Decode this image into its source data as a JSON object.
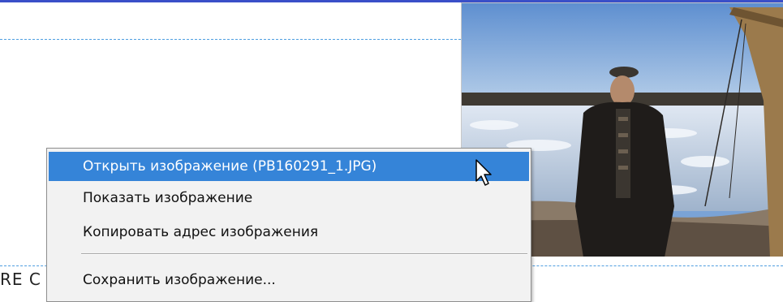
{
  "page": {
    "partial_heading": "RE C"
  },
  "image": {
    "alt": "Photo of a man in a dark winter coat and cap standing on a riverbank with ice floes behind him"
  },
  "context_menu": {
    "items": [
      {
        "label": "Открыть изображение (PB160291_1.JPG)",
        "selected": true
      },
      {
        "label": "Показать изображение",
        "selected": false
      },
      {
        "label": "Копировать адрес изображения",
        "selected": false
      },
      {
        "label": "Сохранить изображение...",
        "selected": false
      }
    ]
  },
  "colors": {
    "selection": "#3584d8",
    "menu_bg": "#f2f2f2",
    "top_rule": "#3a4fc8",
    "dashed_line": "#4f9ee0"
  },
  "icons": {
    "cursor": "mouse-pointer-icon"
  }
}
